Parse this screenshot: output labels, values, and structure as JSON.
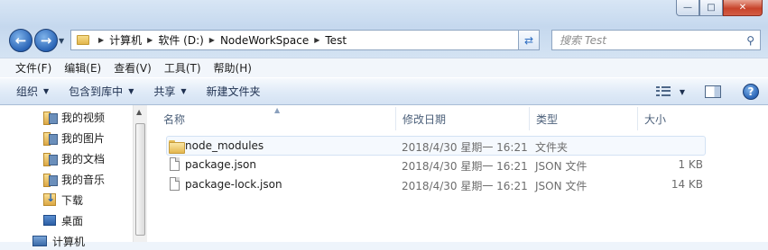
{
  "window": {
    "caption_buttons": {
      "minimize": "—",
      "maximize": "□",
      "close": "✕"
    }
  },
  "nav": {
    "back_glyph": "←",
    "forward_glyph": "→",
    "breadcrumb": [
      "计算机",
      "软件 (D:)",
      "NodeWorkSpace",
      "Test"
    ],
    "search_placeholder": "搜索 Test"
  },
  "menubar": {
    "items": [
      "文件(F)",
      "编辑(E)",
      "查看(V)",
      "工具(T)",
      "帮助(H)"
    ]
  },
  "commandbar": {
    "items": [
      "组织",
      "包含到库中",
      "共享",
      "新建文件夹"
    ]
  },
  "navpane": {
    "items": [
      {
        "label": "我的视频",
        "icon": "library-icon"
      },
      {
        "label": "我的图片",
        "icon": "library-icon"
      },
      {
        "label": "我的文档",
        "icon": "library-icon"
      },
      {
        "label": "我的音乐",
        "icon": "library-icon"
      },
      {
        "label": "下载",
        "icon": "downloads-icon"
      },
      {
        "label": "桌面",
        "icon": "desktop-icon"
      },
      {
        "label": "计算机",
        "icon": "computer-icon"
      }
    ]
  },
  "filelist": {
    "columns": [
      "名称",
      "修改日期",
      "类型",
      "大小"
    ],
    "rows": [
      {
        "name": "node_modules",
        "date": "2018/4/30 星期一 16:21",
        "type": "文件夹",
        "size": "",
        "icon": "folder-icon"
      },
      {
        "name": "package.json",
        "date": "2018/4/30 星期一 16:21",
        "type": "JSON 文件",
        "size": "1 KB",
        "icon": "document-icon"
      },
      {
        "name": "package-lock.json",
        "date": "2018/4/30 星期一 16:21",
        "type": "JSON 文件",
        "size": "14 KB",
        "icon": "document-icon"
      }
    ]
  }
}
